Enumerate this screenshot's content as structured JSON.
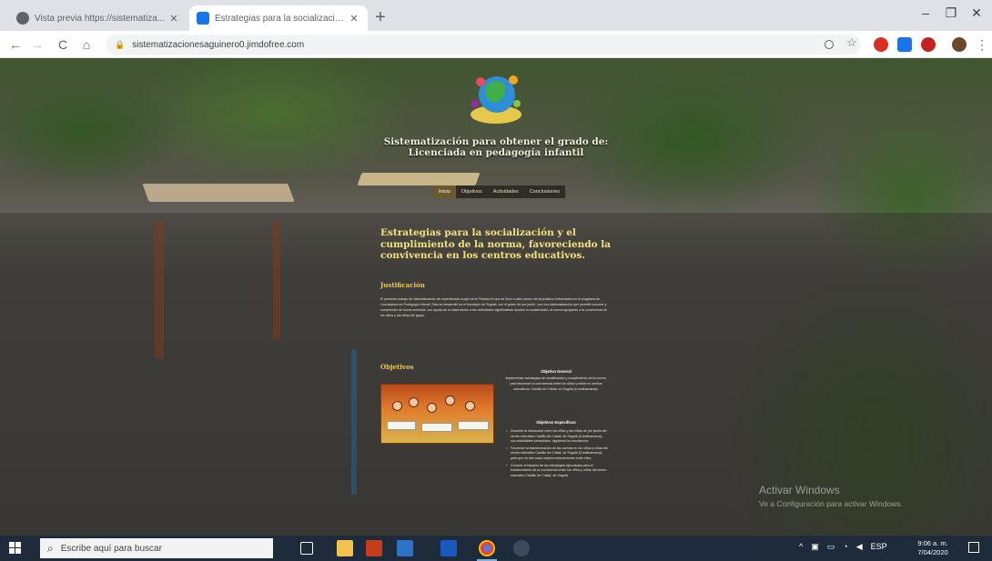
{
  "browser": {
    "tabs": [
      {
        "title": "Vista previa https://sistematiza...",
        "active": false
      },
      {
        "title": "Estrategias para la socialización...",
        "active": true
      }
    ],
    "new_tab": "+",
    "address": "sistematizacionesaguinero0.jimdofree.com",
    "window_controls": {
      "minimize": "–",
      "maximize": "❐",
      "close": "✕"
    },
    "nav": {
      "back": "←",
      "forward": "→",
      "reload": "C",
      "home": "⌂"
    },
    "tab_close": "✕",
    "accent_color": "#1a73e8"
  },
  "site": {
    "title": "Sistematización para obtener el grado de: Licenciada en pedagogía infantil",
    "nav": [
      "Inicio",
      "Objetivos",
      "Actividades",
      "Conclusiones"
    ],
    "page_heading": "Estrategias para la socialización y el cumplimiento de la norma, favoreciendo la convivencia en los centros educativos.",
    "justification": {
      "heading": "Justificación",
      "body": "El presente trabajo de sistematización de experiencias surgió de la Práctica III que se llevó a cabo dentro de la práctica Universitaria en el programa de Licenciatura en Pedagogía Infantil. Esta se desarrolló en el Municipio de Sogotá, con el grado de pre jardín, con una sistematización que permitió conocer y comprender de forma acertada, con ayuda de la observación a las actividades significativas durante la socialización, la norma apoyando a la convivencia de los niños y las niñas del grupo."
    },
    "objectives": {
      "heading": "Objetivos",
      "general_title": "Objetivo General",
      "general_body": "Implementar estrategias de socialización y cumplimiento de la norma, para favorecer la convivencia entre los niños y niñas en centros educativos. Castillo de Cristal, en Sogotá (Cundinamarca).",
      "specific_title": "Objetivos Específicos",
      "specific_items": [
        "Describir la interacción entre los niños y las niñas de pre jardín del centro educativo Castillo de Cristal, de Sogotá (Cundinamarca), con actividades sensoriales, siguiendo la convivencia.",
        "Favorecer la transformación de las normas en los niños y niñas del centro educativo Castillo de Cristal, de Sogotá (Cundinamarca), para que se den unas mejores interacciones entre ellos.",
        "Conocer el impacto de las estrategias ejecutadas para el fortalecimiento de la convivencia entre los niños y niñas del centro educativo Castillo de Cristal, de Sogotá."
      ]
    }
  },
  "watermark": {
    "line1": "Activar Windows",
    "line2": "Ve a Configuración para activar Windows."
  },
  "taskbar": {
    "search_placeholder": "Escribe aquí para buscar",
    "tray_lang": "ESP",
    "clock_time": "9:06 a. m.",
    "clock_date": "7/04/2020",
    "color": "#1d2b3a"
  }
}
